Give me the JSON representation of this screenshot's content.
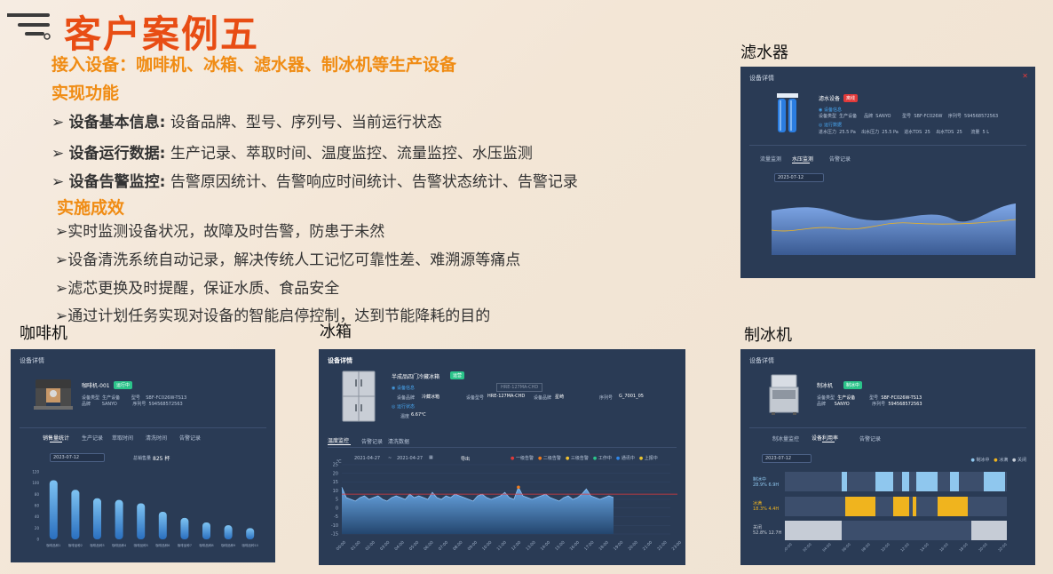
{
  "header": {
    "title": "客户案例五",
    "devices_line": "接入设备：咖啡机、冰箱、滤水器、制冰机等生产设备",
    "features_heading": "实现功能",
    "results_heading": "实施成效"
  },
  "features": [
    {
      "label": "设备基本信息:",
      "text": "设备品牌、型号、序列号、当前运行状态"
    },
    {
      "label": "设备运行数据:",
      "text": "生产记录、萃取时间、温度监控、流量监控、水压监测"
    },
    {
      "label": "设备告警监控:",
      "text": "告警原因统计、告警响应时间统计、告警状态统计、告警记录"
    }
  ],
  "results": [
    "实时监测设备状况，故障及时告警，防患于未然",
    "设备清洗系统自动记录，解决传统人工记忆可靠性差、难溯源等痛点",
    "滤芯更换及时提醒，保证水质、食品安全",
    "通过计划任务实现对设备的智能启停控制，达到节能降耗的目的"
  ],
  "captions": {
    "filter": "滤水器",
    "coffee": "咖啡机",
    "fridge": "冰箱",
    "ice": "制冰机"
  },
  "filter_panel": {
    "header": "设备详情",
    "name": "滤水设备",
    "badge": "离线",
    "tab_active": "水压监测",
    "tab1": "流量监测",
    "tab3": "告警记录",
    "date": "2023-07-12"
  },
  "coffee_panel": {
    "header": "设备详情",
    "name": "咖啡机-001",
    "badge": "运行中",
    "tabs": [
      "销售量统计",
      "生产记录",
      "萃取时间",
      "清洗时间",
      "告警记录"
    ],
    "date": "2023-07-12",
    "total_label": "总销售量",
    "total_value": "825 杯",
    "chart_data": {
      "type": "bar",
      "categories": [
        "咖啡品种1",
        "咖啡品种2",
        "咖啡品种3",
        "咖啡品种4",
        "咖啡品种5",
        "咖啡品种6",
        "咖啡品种7",
        "咖啡品种8",
        "咖啡品种9",
        "咖啡品种10"
      ],
      "values": [
        105,
        88,
        73,
        70,
        64,
        49,
        38,
        30,
        25,
        20
      ],
      "ylim": [
        0,
        120
      ],
      "yticks": [
        0,
        20,
        40,
        60,
        80,
        100,
        120
      ]
    }
  },
  "fridge_panel": {
    "header": "设备详情",
    "name": "半成品四门冷藏冰箱",
    "badge": "运营",
    "plate": "HRE-127MA-CHD",
    "brand_label": "设备品牌",
    "brand": "冷藏冰箱",
    "model_label": "设备型号",
    "model": "HRE-127MA-CHD",
    "maker_label": "设备品牌",
    "maker": "星崎",
    "serial_label": "序列号",
    "serial": "G_7001_05",
    "info_label": "设备信息",
    "status_label": "运行状态",
    "temp_label": "温度",
    "temp_value": "6.67℃",
    "tabs": [
      "温度监控",
      "告警记录",
      "清洗数据"
    ],
    "date_from": "2021-04-27",
    "date_to": "2021-04-27",
    "export": "导出",
    "legend": [
      {
        "name": "一级告警",
        "color": "#e23a3a"
      },
      {
        "name": "二级告警",
        "color": "#f07c1e"
      },
      {
        "name": "三级告警",
        "color": "#f2c230"
      },
      {
        "name": "工作中",
        "color": "#2bc48a"
      },
      {
        "name": "通讯中",
        "color": "#2f86e8"
      },
      {
        "name": "上报中",
        "color": "#e8c42f"
      }
    ],
    "ylabel": "℃",
    "chart_data": {
      "type": "area",
      "ylim": [
        -15,
        25
      ],
      "yticks": [
        -15,
        -10,
        -5,
        0,
        5,
        10,
        15,
        20,
        25
      ],
      "threshold": 8,
      "x": [
        "00:00",
        "01:00",
        "02:00",
        "03:00",
        "04:00",
        "05:00",
        "06:00",
        "07:00",
        "08:00",
        "09:00",
        "10:00",
        "11:00",
        "12:00",
        "13:00",
        "14:00",
        "15:00",
        "16:00",
        "17:00",
        "18:00",
        "19:00",
        "20:00",
        "21:00",
        "22:00",
        "23:00"
      ],
      "values": [
        12,
        6,
        5,
        4,
        6,
        7,
        5,
        6,
        7,
        5,
        4,
        6,
        7,
        6,
        5,
        8,
        6,
        7,
        6,
        5,
        9,
        6,
        5,
        7,
        6,
        8,
        7,
        6,
        5,
        4,
        7,
        8,
        6,
        5,
        6,
        7,
        9,
        6,
        5,
        12,
        7,
        6,
        5,
        6,
        7,
        8,
        6,
        5,
        4,
        6,
        7,
        5,
        6,
        8,
        11,
        7,
        6,
        5,
        6,
        7,
        6
      ]
    }
  },
  "ice_panel": {
    "header": "设备详情",
    "name": "制冰机",
    "badge": "制冰中",
    "brand_label": "设备类型",
    "brand": "生产设备",
    "model_label": "型号",
    "model": "SBF-FC026W-TS13",
    "maker_label": "品牌",
    "maker": "SANYO",
    "serial_label": "序列号",
    "serial": "594568572563",
    "tabs": [
      "制冰量监控",
      "设备利用率",
      "告警记录"
    ],
    "date": "2023-07-12",
    "legend": [
      "制冰中",
      "冰满",
      "关闭"
    ],
    "rows": [
      {
        "label": "制冰中",
        "pct": "28.9% 6.9H",
        "color": "#8fc7ee"
      },
      {
        "label": "冰满",
        "pct": "18.3% 4.4H",
        "color": "#f0b41e"
      },
      {
        "label": "关闭",
        "pct": "52.8% 12.7H",
        "color": "#c6ccd6"
      }
    ]
  }
}
